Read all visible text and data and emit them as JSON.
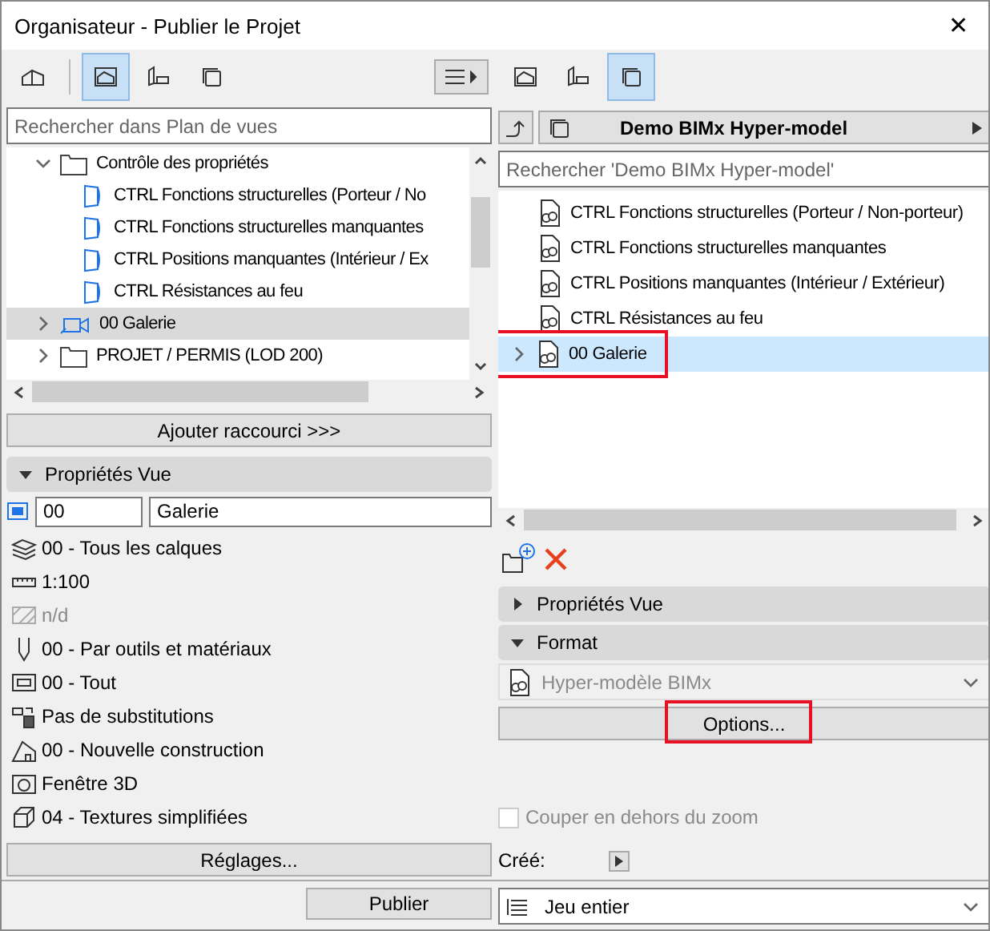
{
  "window": {
    "title": "Organisateur - Publier le Projet",
    "close": "✕"
  },
  "left": {
    "toolbar": [
      {
        "kind": "project",
        "selected": false
      },
      {
        "kind": "views",
        "selected": true
      },
      {
        "kind": "layouts",
        "selected": false
      },
      {
        "kind": "sets",
        "selected": false
      }
    ],
    "search": {
      "placeholder": "Rechercher dans Plan de vues"
    },
    "tree": [
      {
        "label": "Contrôle des propriétés",
        "kind": "folder",
        "expanded": true,
        "selected": false,
        "children": [
          {
            "label": "CTRL Fonctions structurelles (Porteur / No",
            "kind": "view",
            "selected": false
          },
          {
            "label": "CTRL Fonctions structurelles manquantes",
            "kind": "view",
            "selected": false
          },
          {
            "label": "CTRL Positions manquantes (Intérieur / Ex",
            "kind": "view",
            "selected": false
          },
          {
            "label": "CTRL Résistances au feu",
            "kind": "view",
            "selected": false
          }
        ]
      },
      {
        "label": "00 Galerie",
        "kind": "camera",
        "expanded": false,
        "selected": true
      },
      {
        "label": "PROJET / PERMIS (LOD 200)",
        "kind": "folder",
        "expanded": false,
        "selected": false
      }
    ],
    "add_shortcut": "Ajouter raccourci >>>",
    "section": {
      "title": "Propriétés Vue",
      "expanded": true
    },
    "id_field": "00",
    "name_field": "Galerie",
    "properties": [
      {
        "kind": "layers",
        "text": "00 - Tous les calques",
        "disabled": false
      },
      {
        "kind": "scale",
        "text": "1:100",
        "disabled": false
      },
      {
        "kind": "structure",
        "text": "n/d",
        "disabled": true
      },
      {
        "kind": "pen",
        "text": "00 - Par outils et matériaux",
        "disabled": false
      },
      {
        "kind": "model",
        "text": "00 - Tout",
        "disabled": false
      },
      {
        "kind": "override",
        "text": "Pas de substitutions",
        "disabled": false
      },
      {
        "kind": "renovation",
        "text": "00 - Nouvelle construction",
        "disabled": false
      },
      {
        "kind": "camera3d",
        "text": "Fenêtre 3D",
        "disabled": false
      },
      {
        "kind": "cube",
        "text": "04 - Textures simplifiées",
        "disabled": false
      }
    ],
    "settings_button": "Réglages..."
  },
  "right": {
    "toolbar": [
      {
        "kind": "views",
        "selected": false
      },
      {
        "kind": "layouts",
        "selected": false
      },
      {
        "kind": "sets",
        "selected": true
      }
    ],
    "path": "Demo BIMx Hyper-model",
    "search": {
      "placeholder": "Rechercher 'Demo BIMx Hyper-model'"
    },
    "tree": [
      {
        "label": "CTRL Fonctions structurelles (Porteur / Non-porteur)",
        "selected": false,
        "expandable": false
      },
      {
        "label": "CTRL Fonctions structurelles manquantes",
        "selected": false,
        "expandable": false
      },
      {
        "label": "CTRL Positions manquantes (Intérieur / Extérieur)",
        "selected": false,
        "expandable": false
      },
      {
        "label": "CTRL Résistances au feu",
        "selected": false,
        "expandable": false
      },
      {
        "label": "00 Galerie",
        "selected": true,
        "expandable": true,
        "highlighted": true
      }
    ],
    "sections": [
      {
        "title": "Propriétés Vue",
        "expanded": false
      },
      {
        "title": "Format",
        "expanded": true
      }
    ],
    "format": {
      "value": "Hyper-modèle BIMx",
      "disabled": true
    },
    "options_button": {
      "label": "Options...",
      "highlighted": true
    },
    "clip": {
      "label": "Couper en dehors du zoom",
      "checked": false,
      "disabled": true
    },
    "created": "Créé:"
  },
  "bottom": {
    "publish": "Publier",
    "scope": "Jeu entier"
  }
}
